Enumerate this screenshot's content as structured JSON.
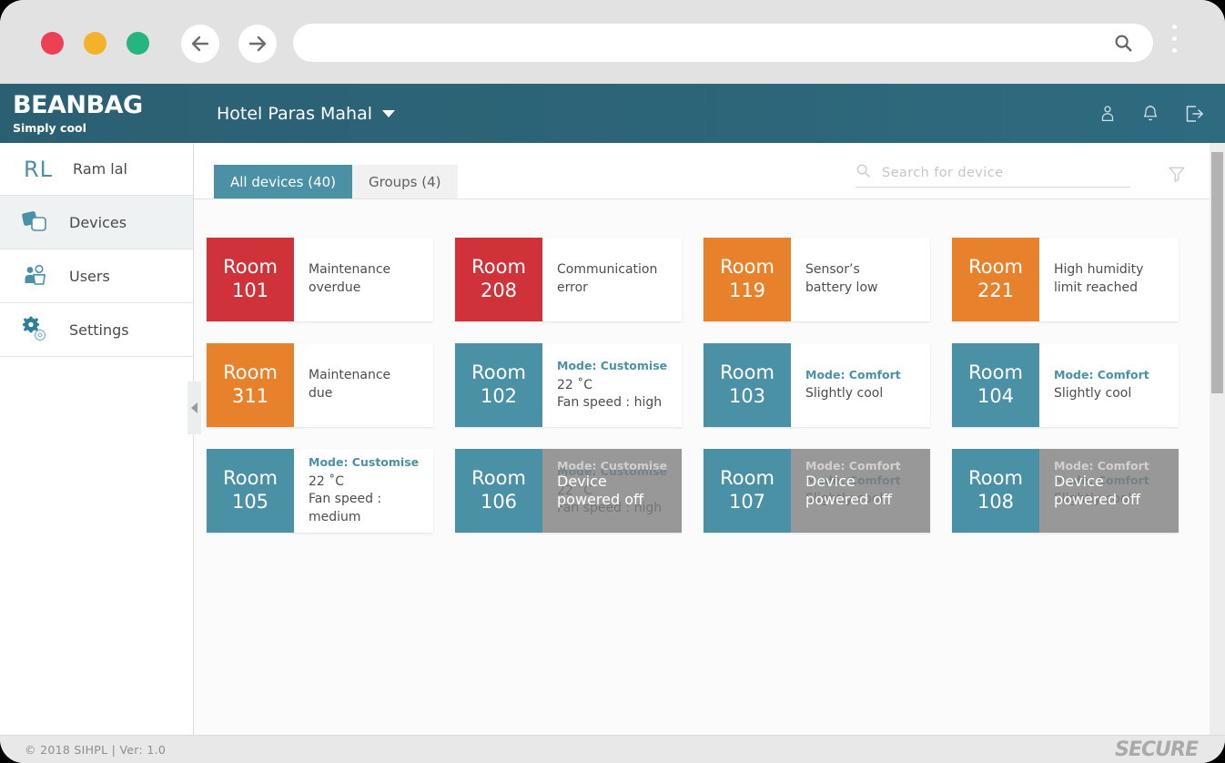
{
  "browser": {
    "traffic_lights": [
      "close",
      "minimize",
      "maximize"
    ],
    "back_label": "Back",
    "forward_label": "Forward",
    "url_value": "",
    "url_placeholder": "",
    "menu_label": "More options"
  },
  "header": {
    "brand_name": "BEANBAG",
    "brand_tagline": "Simply cool",
    "property": "Hotel Paras Mahal",
    "icons": [
      "user-icon",
      "bell-icon",
      "logout-icon"
    ]
  },
  "sidebar": {
    "user": {
      "initials": "RL",
      "name": "Ram lal"
    },
    "items": [
      {
        "label": "Devices",
        "icon": "devices-icon",
        "active": true
      },
      {
        "label": "Users",
        "icon": "users-icon",
        "active": false
      },
      {
        "label": "Settings",
        "icon": "settings-gear-icon",
        "active": false
      }
    ],
    "collapse_label": "Collapse panel"
  },
  "toolbar": {
    "tabs": [
      {
        "label": "All devices (40)",
        "active": true
      },
      {
        "label": "Groups (4)",
        "active": false
      }
    ],
    "search_value": "",
    "search_placeholder": "Search for device",
    "filter_label": "Filter"
  },
  "colors": {
    "header_teal": "#2d6578",
    "accent_teal": "#4b91a6",
    "alert_red": "#cf3339",
    "warn_orange": "#e8812c",
    "powered_off_gray": "#7e7e7e"
  },
  "devices": [
    {
      "room_label": "Room",
      "room_number": "101",
      "tone": "red",
      "mode": null,
      "lines": [
        "Maintenance",
        "overdue"
      ],
      "powered_off": false
    },
    {
      "room_label": "Room",
      "room_number": "208",
      "tone": "red",
      "mode": null,
      "lines": [
        "Communication",
        "error"
      ],
      "powered_off": false
    },
    {
      "room_label": "Room",
      "room_number": "119",
      "tone": "orange",
      "mode": null,
      "lines": [
        "Sensor’s",
        "battery low"
      ],
      "powered_off": false
    },
    {
      "room_label": "Room",
      "room_number": "221",
      "tone": "orange",
      "mode": null,
      "lines": [
        "High humidity",
        "limit reached"
      ],
      "powered_off": false
    },
    {
      "room_label": "Room",
      "room_number": "311",
      "tone": "orange",
      "mode": null,
      "lines": [
        "Maintenance",
        "due"
      ],
      "powered_off": false
    },
    {
      "room_label": "Room",
      "room_number": "102",
      "tone": "teal",
      "mode": "Mode: Customise",
      "lines": [
        "22 ˚C",
        "Fan speed : high"
      ],
      "powered_off": false
    },
    {
      "room_label": "Room",
      "room_number": "103",
      "tone": "teal",
      "mode": "Mode: Comfort",
      "lines": [
        "Slightly cool"
      ],
      "powered_off": false
    },
    {
      "room_label": "Room",
      "room_number": "104",
      "tone": "teal",
      "mode": "Mode: Comfort",
      "lines": [
        "Slightly cool"
      ],
      "powered_off": false
    },
    {
      "room_label": "Room",
      "room_number": "105",
      "tone": "teal",
      "mode": "Mode: Customise",
      "lines": [
        "22 ˚C",
        "Fan speed : medium"
      ],
      "powered_off": false
    },
    {
      "room_label": "Room",
      "room_number": "106",
      "tone": "teal",
      "mode": "Mode: Customise",
      "lines": [
        "22 ˚C",
        "Fan speed : high"
      ],
      "powered_off": true,
      "off_text": "Device powered off"
    },
    {
      "room_label": "Room",
      "room_number": "107",
      "tone": "teal",
      "mode": "Mode: Comfort",
      "lines": [
        "Slightly cool"
      ],
      "powered_off": true,
      "off_text": "Device powered off"
    },
    {
      "room_label": "Room",
      "room_number": "108",
      "tone": "teal",
      "mode": "Mode: Comfort",
      "lines": [
        "Slightly cool"
      ],
      "powered_off": true,
      "off_text": "Device powered off"
    }
  ],
  "footer": {
    "copyright": "© 2018 SIHPL  |   Ver: 1.0",
    "vendor_logo": "SECURE"
  }
}
